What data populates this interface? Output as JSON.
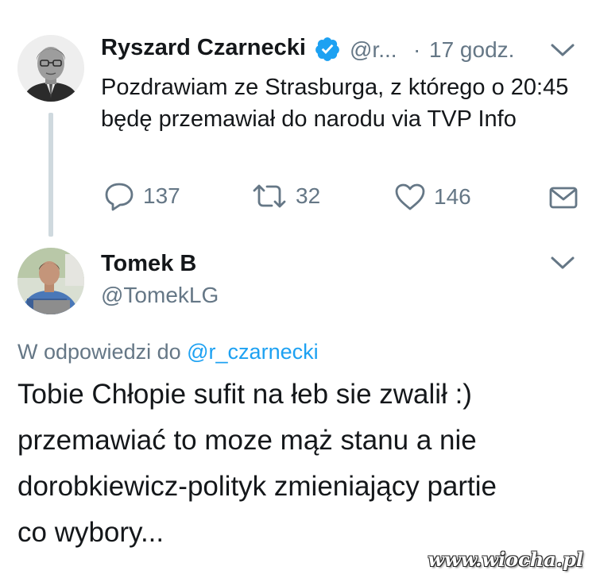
{
  "tweet1": {
    "author_name": "Ryszard Czarnecki",
    "handle": "@r...",
    "separator": "·",
    "time": "17 godz.",
    "text": "Pozdrawiam ze Strasburga, z którego o 20:45 będę przemawiał do narodu via TVP Info",
    "replies": "137",
    "retweets": "32",
    "likes": "146",
    "verified_icon": "verified-badge-icon",
    "verified_color": "#1da1f2"
  },
  "tweet2": {
    "author_name": "Tomek B",
    "handle": "@TomekLG",
    "reply_prefix": "W odpowiedzi do",
    "reply_to_handle": "@r_czarnecki",
    "text_lines": [
      "Tobie Chłopie sufit na łeb sie zwalił :)",
      "przemawiać to moze mąż stanu a nie",
      "dorobkiewicz-polityk zmieniający partie",
      "co wybory..."
    ]
  },
  "watermark": "www.wiocha.pl",
  "colors": {
    "primary_text": "#14171a",
    "secondary_text": "#657786",
    "link": "#1da1f2",
    "thread_line": "#cfd9de"
  }
}
